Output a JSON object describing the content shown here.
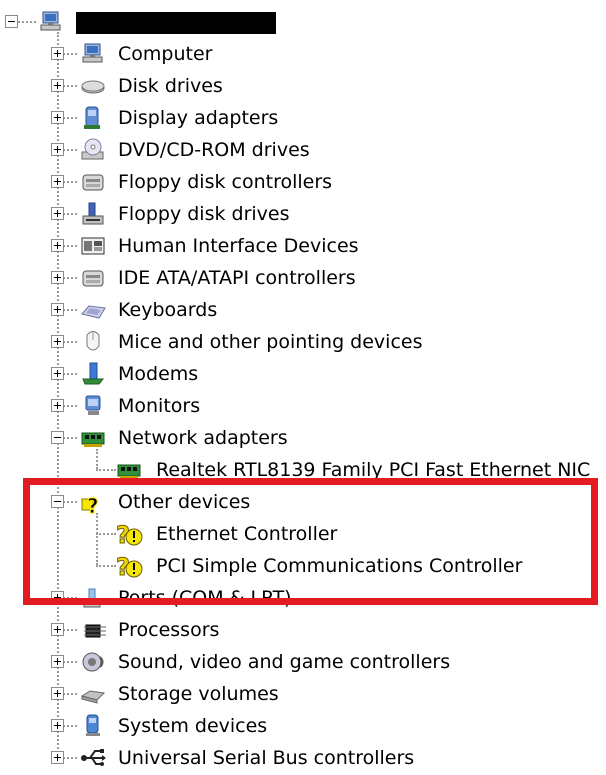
{
  "root": {
    "icon": "computer-icon"
  },
  "items": [
    {
      "key": "computer",
      "label": "Computer",
      "icon": "computer-icon",
      "expanded": false
    },
    {
      "key": "disk-drives",
      "label": "Disk drives",
      "icon": "disk-drive-icon",
      "expanded": false
    },
    {
      "key": "display-adapters",
      "label": "Display adapters",
      "icon": "display-adapter-icon",
      "expanded": false
    },
    {
      "key": "dvd-cd-rom-drives",
      "label": "DVD/CD-ROM drives",
      "icon": "dvd-drive-icon",
      "expanded": false
    },
    {
      "key": "floppy-disk-controllers",
      "label": "Floppy disk controllers",
      "icon": "controller-icon",
      "expanded": false
    },
    {
      "key": "floppy-disk-drives",
      "label": "Floppy disk drives",
      "icon": "floppy-drive-icon",
      "expanded": false
    },
    {
      "key": "human-interface-devices",
      "label": "Human Interface Devices",
      "icon": "hid-icon",
      "expanded": false
    },
    {
      "key": "ide-ata-atapi-controllers",
      "label": "IDE ATA/ATAPI controllers",
      "icon": "controller-icon",
      "expanded": false
    },
    {
      "key": "keyboards",
      "label": "Keyboards",
      "icon": "keyboard-icon",
      "expanded": false
    },
    {
      "key": "mice",
      "label": "Mice and other pointing devices",
      "icon": "mouse-icon",
      "expanded": false
    },
    {
      "key": "modems",
      "label": "Modems",
      "icon": "modem-icon",
      "expanded": false
    },
    {
      "key": "monitors",
      "label": "Monitors",
      "icon": "monitor-icon",
      "expanded": false
    },
    {
      "key": "network-adapters",
      "label": "Network adapters",
      "icon": "network-adapter-icon",
      "expanded": true,
      "children": [
        {
          "key": "realtek-nic",
          "label": "Realtek RTL8139 Family PCI Fast Ethernet NIC",
          "icon": "network-adapter-icon"
        }
      ]
    },
    {
      "key": "other-devices",
      "label": "Other devices",
      "icon": "unknown-device-icon",
      "expanded": true,
      "children": [
        {
          "key": "ethernet-controller",
          "label": "Ethernet Controller",
          "icon": "warning-device-icon"
        },
        {
          "key": "pci-simple-comm-controller",
          "label": "PCI Simple Communications Controller",
          "icon": "warning-device-icon"
        }
      ]
    },
    {
      "key": "ports",
      "label": "Ports (COM & LPT)",
      "icon": "port-icon",
      "expanded": false
    },
    {
      "key": "processors",
      "label": "Processors",
      "icon": "processor-icon",
      "expanded": false
    },
    {
      "key": "sound-video-game",
      "label": "Sound, video and game controllers",
      "icon": "sound-icon",
      "expanded": false
    },
    {
      "key": "storage-volumes",
      "label": "Storage volumes",
      "icon": "storage-volume-icon",
      "expanded": false
    },
    {
      "key": "system-devices",
      "label": "System devices",
      "icon": "system-device-icon",
      "expanded": false
    },
    {
      "key": "usb-controllers",
      "label": "Universal Serial Bus controllers",
      "icon": "usb-icon",
      "expanded": false
    }
  ],
  "colors": {
    "highlight": "#e31b23",
    "warning": "#f7e700",
    "tree_line": "#9a9a9a"
  }
}
